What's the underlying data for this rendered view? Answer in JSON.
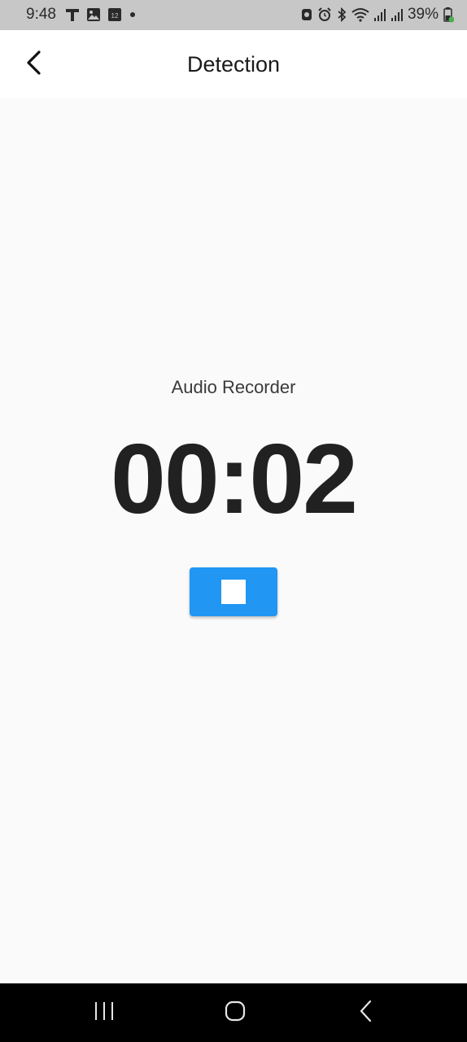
{
  "status_bar": {
    "time": "9:48",
    "battery_percent": "39%",
    "notification_icons": [
      "t-mobile-icon",
      "image-icon",
      "calendar-icon",
      "dot-icon"
    ],
    "calendar_day": "12",
    "system_icons": [
      "screenshot-icon",
      "alarm-icon",
      "bluetooth-icon",
      "wifi-icon",
      "signal-icon",
      "signal-icon",
      "battery-icon"
    ]
  },
  "app_bar": {
    "title": "Detection",
    "back_icon": "chevron-left-icon"
  },
  "recorder": {
    "label": "Audio Recorder",
    "timer": "00:02",
    "stop_icon": "stop-icon",
    "button_color": "#2196f3"
  },
  "nav_bar": {
    "buttons": [
      "recents-icon",
      "home-icon",
      "back-icon"
    ]
  }
}
